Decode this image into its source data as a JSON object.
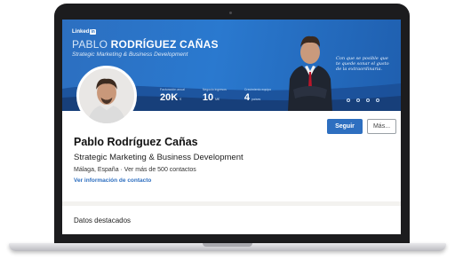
{
  "banner": {
    "logo_text": "Linked",
    "logo_in": "in",
    "name_first": "PABLO ",
    "name_rest": "RODRÍGUEZ CAÑAS",
    "subtitle": "Strategic Marketing & Business Development",
    "stats": [
      {
        "caption": "Facturación anual",
        "value": "20K",
        "unit": "€"
      },
      {
        "caption": "Negocio ingresos",
        "value": "10",
        "unit": "M€"
      },
      {
        "caption": "Crecimiento equipo",
        "value": "4",
        "unit": "países"
      }
    ],
    "quote": "Con que se posible que te quede sonar el gusto de la extraordinaria.",
    "colors": {
      "primary": "#2a79cf",
      "dark": "#1f5faf"
    }
  },
  "profile": {
    "name": "Pablo Rodríguez Cañas",
    "headline": "Strategic Marketing & Business Development",
    "location": "Málaga, España · Ver más de 500 contactos",
    "contact_link": "Ver información de contacto",
    "follow_button": "Seguir",
    "more_button": "Más..."
  },
  "featured": {
    "title": "Datos destacados"
  }
}
